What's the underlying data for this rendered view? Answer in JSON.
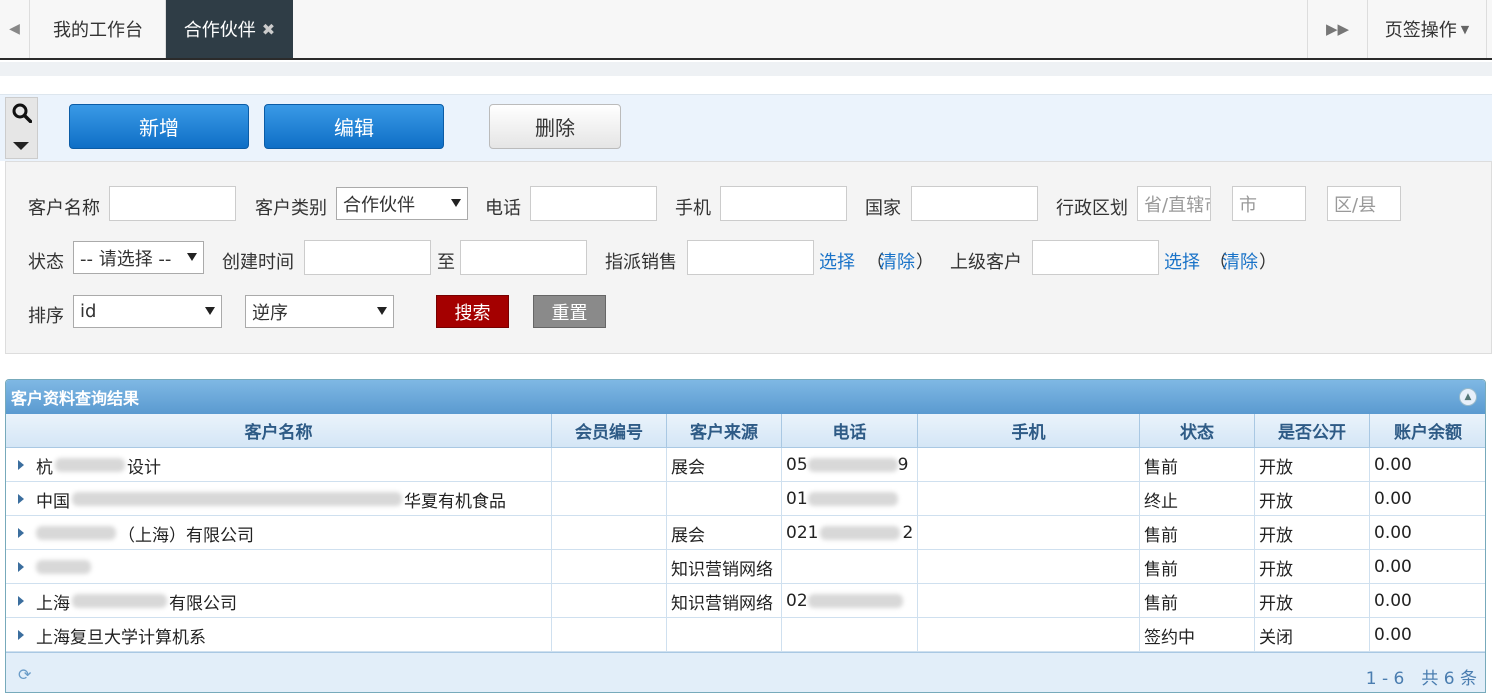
{
  "tabs": {
    "tab1": "我的工作台",
    "tab2": "合作伙伴",
    "close": "✖",
    "ops": "页签操作"
  },
  "toolbar": {
    "add": "新增",
    "edit": "编辑",
    "delete": "删除"
  },
  "filter": {
    "customer_name": "客户名称",
    "customer_type": "客户类别",
    "customer_type_value": "合作伙伴",
    "phone": "电话",
    "mobile": "手机",
    "country": "国家",
    "region": "行政区划",
    "province_placeholder": "省/直辖市",
    "city_placeholder": "市",
    "district_placeholder": "区/县",
    "status": "状态",
    "status_value": "-- 请选择 --",
    "created": "创建时间",
    "to": "至",
    "sales": "指派销售",
    "select": "选择",
    "clear_open": "（",
    "clear": "清除",
    "clear_close": "）",
    "parent": "上级客户",
    "sort": "排序",
    "sort_field": "id",
    "sort_order": "逆序",
    "search": "搜索",
    "reset": "重置"
  },
  "grid": {
    "title": "客户资料查询结果",
    "columns": [
      "客户名称",
      "会员编号",
      "客户来源",
      "电话",
      "手机",
      "状态",
      "是否公开",
      "账户余额"
    ],
    "rows": [
      {
        "name": "杭",
        "name_tail": "设计",
        "source": "展会",
        "phone": "05",
        "phone_tail": "9",
        "status": "售前",
        "public": "开放",
        "balance": "0.00"
      },
      {
        "name": "中国",
        "name_tail": "华夏有机食品",
        "source": "",
        "phone": "01",
        "phone_tail": "",
        "status": "终止",
        "public": "开放",
        "balance": "0.00"
      },
      {
        "name": "",
        "name_tail": "（上海）有限公司",
        "source": "展会",
        "phone": "021",
        "phone_tail": "2",
        "status": "售前",
        "public": "开放",
        "balance": "0.00"
      },
      {
        "name": "",
        "name_tail": "",
        "source": "知识营销网络",
        "phone": "",
        "phone_tail": "",
        "status": "售前",
        "public": "开放",
        "balance": "0.00"
      },
      {
        "name": "上海",
        "name_tail": "有限公司",
        "source": "知识营销网络",
        "phone": "02",
        "phone_tail": "",
        "status": "售前",
        "public": "开放",
        "balance": "0.00"
      },
      {
        "name": "上海复旦大学计算机系",
        "name_tail": "",
        "source": "",
        "phone": "",
        "phone_tail": "",
        "status": "签约中",
        "public": "关闭",
        "balance": "0.00"
      }
    ],
    "pager": "1 - 6　共 6 条"
  }
}
